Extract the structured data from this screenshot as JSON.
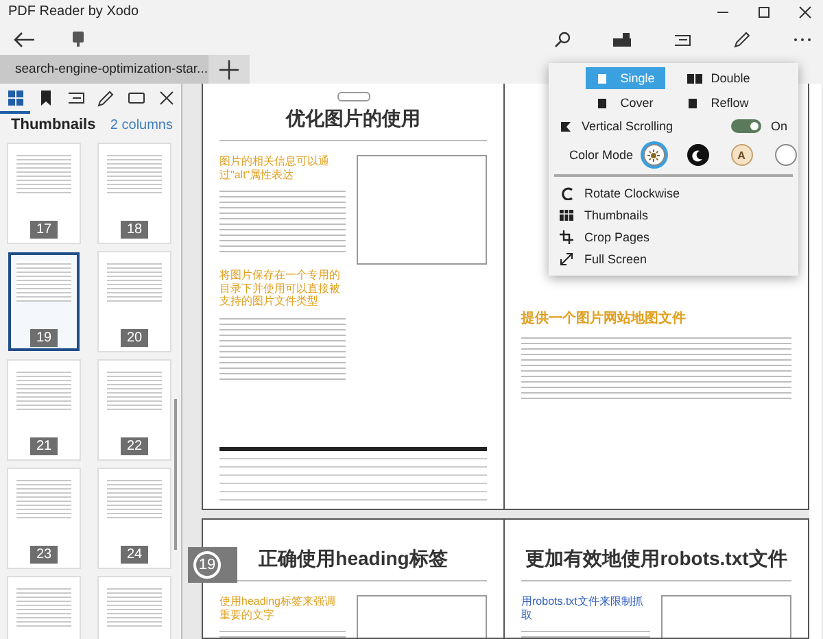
{
  "window": {
    "title": "PDF Reader by Xodo"
  },
  "doc_tabs": [
    {
      "title": "search-engine-optimization-star...",
      "selected": true
    }
  ],
  "sidebar": {
    "tabs": [
      {
        "kind": "thumbnails",
        "selected": true
      },
      {
        "kind": "bookmarks",
        "selected": false
      },
      {
        "kind": "outline",
        "selected": false
      },
      {
        "kind": "annotations",
        "selected": false
      },
      {
        "kind": "layers",
        "selected": false
      }
    ],
    "heading": "Thumbnails",
    "columns_link": "2 columns",
    "thumbnails": [
      {
        "label": "17",
        "selected": false
      },
      {
        "label": "18",
        "selected": false
      },
      {
        "label": "19",
        "selected": true
      },
      {
        "label": "20",
        "selected": false
      },
      {
        "label": "21",
        "selected": false
      },
      {
        "label": "22",
        "selected": false
      },
      {
        "label": "23",
        "selected": false
      },
      {
        "label": "24",
        "selected": false
      },
      {
        "selected": false
      },
      {
        "selected": false
      }
    ]
  },
  "pages": [
    {
      "badge": true,
      "title": "优化图片的使用",
      "sections": [
        "图片的相关信息可以通过\"alt\"属性表达",
        "将图片保存在一个专用的目录下并使用可以直接被支持的图片文件类型"
      ],
      "figure": true
    },
    {
      "sections": [
        "提供一个图片网站地图文件"
      ],
      "figure": false
    },
    {
      "title": "正确使用heading标签",
      "sections": [
        "使用heading标签来强调重要的文字"
      ],
      "figure": true
    },
    {
      "title": "更加有效地使用robots.txt文件",
      "sections": [
        "用robots.txt文件来限制抓取"
      ],
      "figure": true
    }
  ],
  "page_indicator": "19",
  "view_menu": {
    "modes": [
      {
        "kind": "single",
        "label": "Single",
        "selected": true
      },
      {
        "kind": "double",
        "label": "Double",
        "selected": false
      },
      {
        "kind": "cover",
        "label": "Cover",
        "selected": false
      },
      {
        "kind": "reflow",
        "label": "Reflow",
        "selected": false
      }
    ],
    "vertical_scrolling": {
      "label": "Vertical Scrolling",
      "on": true,
      "state_text": "On"
    },
    "color_mode": {
      "label": "Color Mode",
      "options": [
        {
          "kind": "day",
          "selected": true
        },
        {
          "kind": "night",
          "selected": false
        },
        {
          "kind": "sepia",
          "glyph": "A",
          "selected": false
        },
        {
          "kind": "custom",
          "selected": false
        }
      ]
    },
    "actions": [
      {
        "kind": "rotate",
        "label": "Rotate Clockwise"
      },
      {
        "kind": "thumbnails",
        "label": "Thumbnails"
      },
      {
        "kind": "crop",
        "label": "Crop Pages"
      },
      {
        "kind": "fullscreen",
        "label": "Full Screen"
      }
    ]
  }
}
